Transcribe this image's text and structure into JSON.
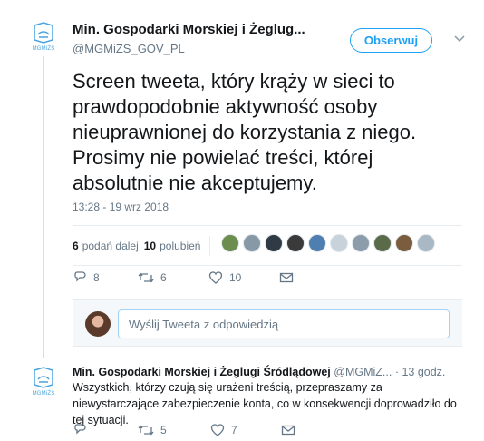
{
  "tweet": {
    "author_name": "Min. Gospodarki Morskiej i Żeglug...",
    "author_handle": "@MGMiZS_GOV_PL",
    "logo_text": "MGMiŻS",
    "follow_label": "Obserwuj",
    "text": "Screen tweeta, który krąży w sieci to\nprawdopodobnie aktywność osoby\nnieuprawnionej do korzystania z niego.\nProsimy nie powielać treści,  której\nabsolutnie nie akceptujemy.",
    "timestamp": "13:28 - 19 wrz 2018",
    "retweets_count": "6",
    "retweets_label": "podań dalej",
    "likes_count": "10",
    "likes_label": "polubień",
    "actions": {
      "replies": "8",
      "retweets": "6",
      "likes": "10"
    }
  },
  "reply_composer": {
    "placeholder": "Wyślij Tweeta z odpowiedzią"
  },
  "reply_tweet": {
    "author_name": "Min. Gospodarki Morskiej i Żeglugi Śródlądowej",
    "author_handle": "@MGMiZ...",
    "time": "· 13 godz.",
    "logo_text": "MGMiŻS",
    "text": "Wszystkich, którzy czują się urażeni treścią, przepraszamy za niewystarczające zabezpieczenie konta, co w konsekwencji doprowadziło do tej sytuacji.",
    "actions": {
      "replies": "",
      "retweets": "5",
      "likes": "7"
    }
  },
  "colors": {
    "accent": "#1da1f2",
    "text": "#14171a",
    "secondary": "#657786",
    "thread": "#c4e5f7"
  },
  "likers": [
    "#6b8e4e",
    "#8899a6",
    "#2f3a44",
    "#3a3a3a",
    "#4f7fb1",
    "#c8d2da",
    "#8c9cab",
    "#5a6b4a",
    "#7a5c3e",
    "#a8b8c4"
  ]
}
